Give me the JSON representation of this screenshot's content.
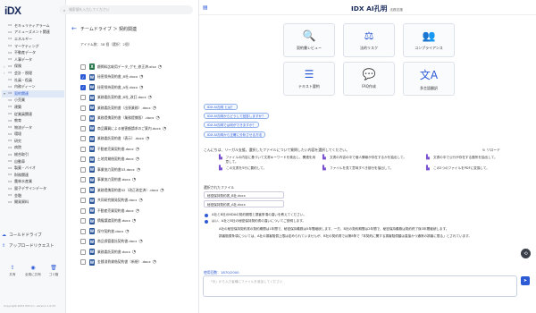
{
  "app": {
    "logo": "iDX",
    "copyright": "Copyright 2023 IDX Inc. version 1.0.33"
  },
  "sidebar": {
    "items": [
      {
        "label": "セキュリティアラーム",
        "chev": "",
        "icon": "▭"
      },
      {
        "label": "アミューズメント関連",
        "chev": "",
        "icon": "▭"
      },
      {
        "label": "エネルギー",
        "chev": "",
        "icon": "▭"
      },
      {
        "label": "マーケティング",
        "chev": "",
        "icon": "▭"
      },
      {
        "label": "不動産データ",
        "chev": "",
        "icon": "▭"
      },
      {
        "label": "人事データ",
        "chev": "",
        "icon": "▭"
      },
      {
        "label": "保険",
        "chev": "›",
        "icon": "▭"
      },
      {
        "label": "会計・税理",
        "chev": "›",
        "icon": "▭"
      },
      {
        "label": "社員・役員",
        "chev": "",
        "icon": "▭"
      },
      {
        "label": "内務ディーン",
        "chev": "",
        "icon": "▭"
      },
      {
        "label": "契約関連",
        "chev": "▾",
        "icon": "▭",
        "active": true
      },
      {
        "label": "小売業",
        "chev": "",
        "icon": "▭"
      },
      {
        "label": "建築",
        "chev": "",
        "icon": "▭"
      },
      {
        "label": "従業員関連",
        "chev": "",
        "icon": "▭"
      },
      {
        "label": "教育",
        "chev": "",
        "icon": "▭"
      },
      {
        "label": "物流データ",
        "chev": "",
        "icon": "▭"
      },
      {
        "label": "環境",
        "chev": "",
        "icon": "▭"
      },
      {
        "label": "研究",
        "chev": "",
        "icon": "▭"
      },
      {
        "label": "病院",
        "chev": "",
        "icon": "▭"
      },
      {
        "label": "総合取引",
        "chev": "",
        "icon": "▭"
      },
      {
        "label": "自動車",
        "chev": "",
        "icon": "▭"
      },
      {
        "label": "製薬・バイオ",
        "chev": "",
        "icon": "▭"
      },
      {
        "label": "財務関連",
        "chev": "",
        "icon": "▭"
      },
      {
        "label": "農林水産業",
        "chev": "",
        "icon": "▭"
      },
      {
        "label": "量子デザインデータ",
        "chev": "",
        "icon": "▭"
      },
      {
        "label": "金融",
        "chev": "",
        "icon": "▭"
      },
      {
        "label": "開発資料",
        "chev": "",
        "icon": "▭"
      }
    ],
    "sections": [
      "コールドドライブ",
      "アップロードリクエスト"
    ],
    "bottom": [
      {
        "label": "共有",
        "icon": "⇪"
      },
      {
        "label": "全員に共有",
        "icon": "◉"
      },
      {
        "label": "ゴミ箱",
        "icon": "🗑"
      }
    ]
  },
  "search": {
    "placeholder": "検索値を入力してください",
    "icon": "⌕"
  },
  "files": {
    "back_icon": "←",
    "breadcrumb": "チームドライブ ＞ 契約関連",
    "count": "アイテム数：38 個（選択：2個）",
    "rows": [
      {
        "name": "顧問料比較用データ_ゲモ_修正済.xlsx",
        "type": "X",
        "checked": false
      },
      {
        "name": "秘密保持契約書_B社.docx",
        "type": "W",
        "checked": true
      },
      {
        "name": "秘密保持契約書_A社.docx",
        "type": "W",
        "checked": true
      },
      {
        "name": "業務委託契約書_B社_改訂.docx",
        "type": "W",
        "checked": false
      },
      {
        "name": "業務委託契約書（出張業務）.docx",
        "type": "W",
        "checked": false
      },
      {
        "name": "業務提携契約書（業務提携版）.docx",
        "type": "W",
        "checked": false
      },
      {
        "name": "商品購買による被害額請求のご案内.docx",
        "type": "W",
        "checked": false
      },
      {
        "name": "業務委託契約書（表示）.docx",
        "type": "W",
        "checked": false
      },
      {
        "name": "不動産売買契約書.docx",
        "type": "W",
        "checked": false
      },
      {
        "name": "土地賃貸借契約書.docx",
        "type": "W",
        "checked": false
      },
      {
        "name": "事業協力契約書03.docx",
        "type": "W",
        "checked": false
      },
      {
        "name": "事業協力契約書.docx",
        "type": "W",
        "checked": false
      },
      {
        "name": "業務提携契約書02（改正改定済）.docx",
        "type": "W",
        "checked": false
      },
      {
        "name": "共同研究開発契約書.docx",
        "type": "W",
        "checked": false
      },
      {
        "name": "不動産売買契約書.docx",
        "type": "W",
        "checked": false
      },
      {
        "name": "債権譲渡契約書.docx",
        "type": "W",
        "checked": false
      },
      {
        "name": "保守契約書.docx",
        "type": "W",
        "checked": false
      },
      {
        "name": "商品保管委託契約書.docx",
        "type": "W",
        "checked": false
      },
      {
        "name": "業務委託契約書.docx",
        "type": "W",
        "checked": false
      },
      {
        "name": "金銭消費貸借契約書（新規）.docx",
        "type": "W",
        "checked": false
      }
    ]
  },
  "ai": {
    "menu_icon": "▤",
    "title": "IDX AI孔明",
    "subtitle": "法務支援",
    "tools": [
      {
        "label": "契約書レビュー",
        "icon": "🔍"
      },
      {
        "label": "法的リスク",
        "icon": "⚖"
      },
      {
        "label": "コンプライアンス",
        "icon": "👥"
      },
      {
        "label": "テキスト要約",
        "icon": "☰"
      },
      {
        "label": "FAQ作成",
        "icon": "💬"
      },
      {
        "label": "多言語翻訳",
        "icon": "文A"
      }
    ],
    "prompts": [
      "IDX AI孔明 とは？",
      "IDX AI孔明からどうして回答しますか？",
      "IDX AI孔明では何ができますか？",
      "IDX AI孔明から正確に分析させる方法"
    ],
    "note": "こんにちは、リーガル支援。選択したファイルについて質問したい内容を選択してください。",
    "reload": "↻ リロード",
    "actions": [
      {
        "text": "ファイルの内容に基づいて文書キーワードを検出し、関連を用意して。",
        "icon": "▙"
      },
      {
        "text": "文書の内容の中で個人情報が存在するかを抽出して。",
        "icon": "▙"
      },
      {
        "text": "文書の中で公行が存在する箇所を抽出して。",
        "icon": "▙"
      },
      {
        "text": "この文書を5行に要約して。",
        "icon": "▙"
      },
      {
        "text": "ファイルを見て意味すべき部分を抽出して。",
        "icon": "▙"
      },
      {
        "text": "この2つのファイルをPDFに変換して。",
        "icon": "▙"
      }
    ],
    "selected_label": "選択されたファイル",
    "selected_files": [
      "秘密保持契約書_B社.docx",
      "秘密保持契約書_A社.docx"
    ],
    "question": "A社とB社のNDAの契約期限と損害条項の違いを教えてください。",
    "answer_intro": "はい、A社とB社の秘密保持契約書の違いについてご説明します。",
    "answer_p1": "A社の秘密保持契約書の契約期間は1年間で、秘密保持義務は5年間継続します。一方、B社の契約期間は2年間で、秘密保持義務は契約終了後3年間継続します。",
    "answer_p2": "損害賠償条項については、A社の損害賠償上限は定められていませんが、B社の契約書では第8条で「本契約に関する損害賠償額は直接かつ通常の損害に限る」とされています。",
    "history_icon": "⟲",
    "char_count": "使用回数：1870/2000",
    "input_placeholder": "「@」から入力者種にファイルを追加してください",
    "send_icon": "➤"
  }
}
